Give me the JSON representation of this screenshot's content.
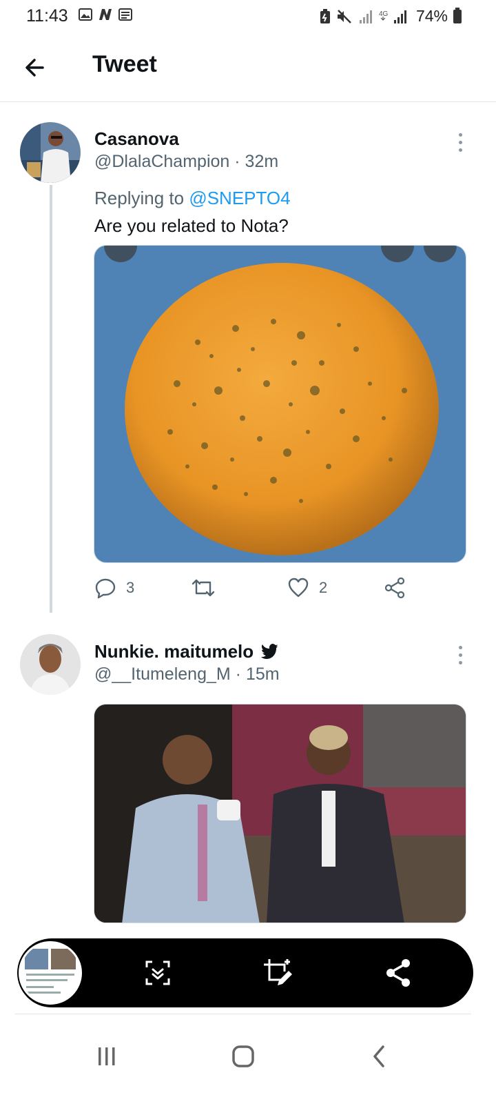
{
  "status_bar": {
    "time": "11:43",
    "left_icons": [
      "gallery-icon",
      "app-n-icon",
      "news-icon"
    ],
    "right_icons": [
      "battery-saver-icon",
      "mute-icon",
      "signal-icon",
      "4g-signal-icon"
    ],
    "battery": "74%"
  },
  "header": {
    "back_icon": "arrow-left-icon",
    "title": "Tweet"
  },
  "tweets": [
    {
      "name": "Casanova",
      "handle": "@DlalaChampion",
      "time": "· 32m",
      "replying_prefix": "Replying to",
      "replying_mention": "@SNEPTO4",
      "text": "Are you related to Nota?",
      "media": "orange-fruit-photo",
      "actions": {
        "reply_count": "3",
        "retweet_count": "",
        "like_count": "2"
      }
    },
    {
      "name": "Nunkie. maitumelo",
      "verified_icon": "twitter-bird-icon",
      "handle": "@__Itumeleng_M",
      "time": "· 15m",
      "media": "two-people-seated-photo"
    }
  ],
  "capture_toolbar": {
    "buttons": [
      "scroll-capture-icon",
      "crop-edit-icon",
      "share-icon"
    ]
  },
  "nav_bar": {
    "buttons": [
      "recent-apps-icon",
      "home-icon",
      "back-chevron-icon"
    ]
  },
  "colors": {
    "accent": "#1d9bf0",
    "muted_text": "#536471",
    "thread_line": "#cfd9de"
  }
}
